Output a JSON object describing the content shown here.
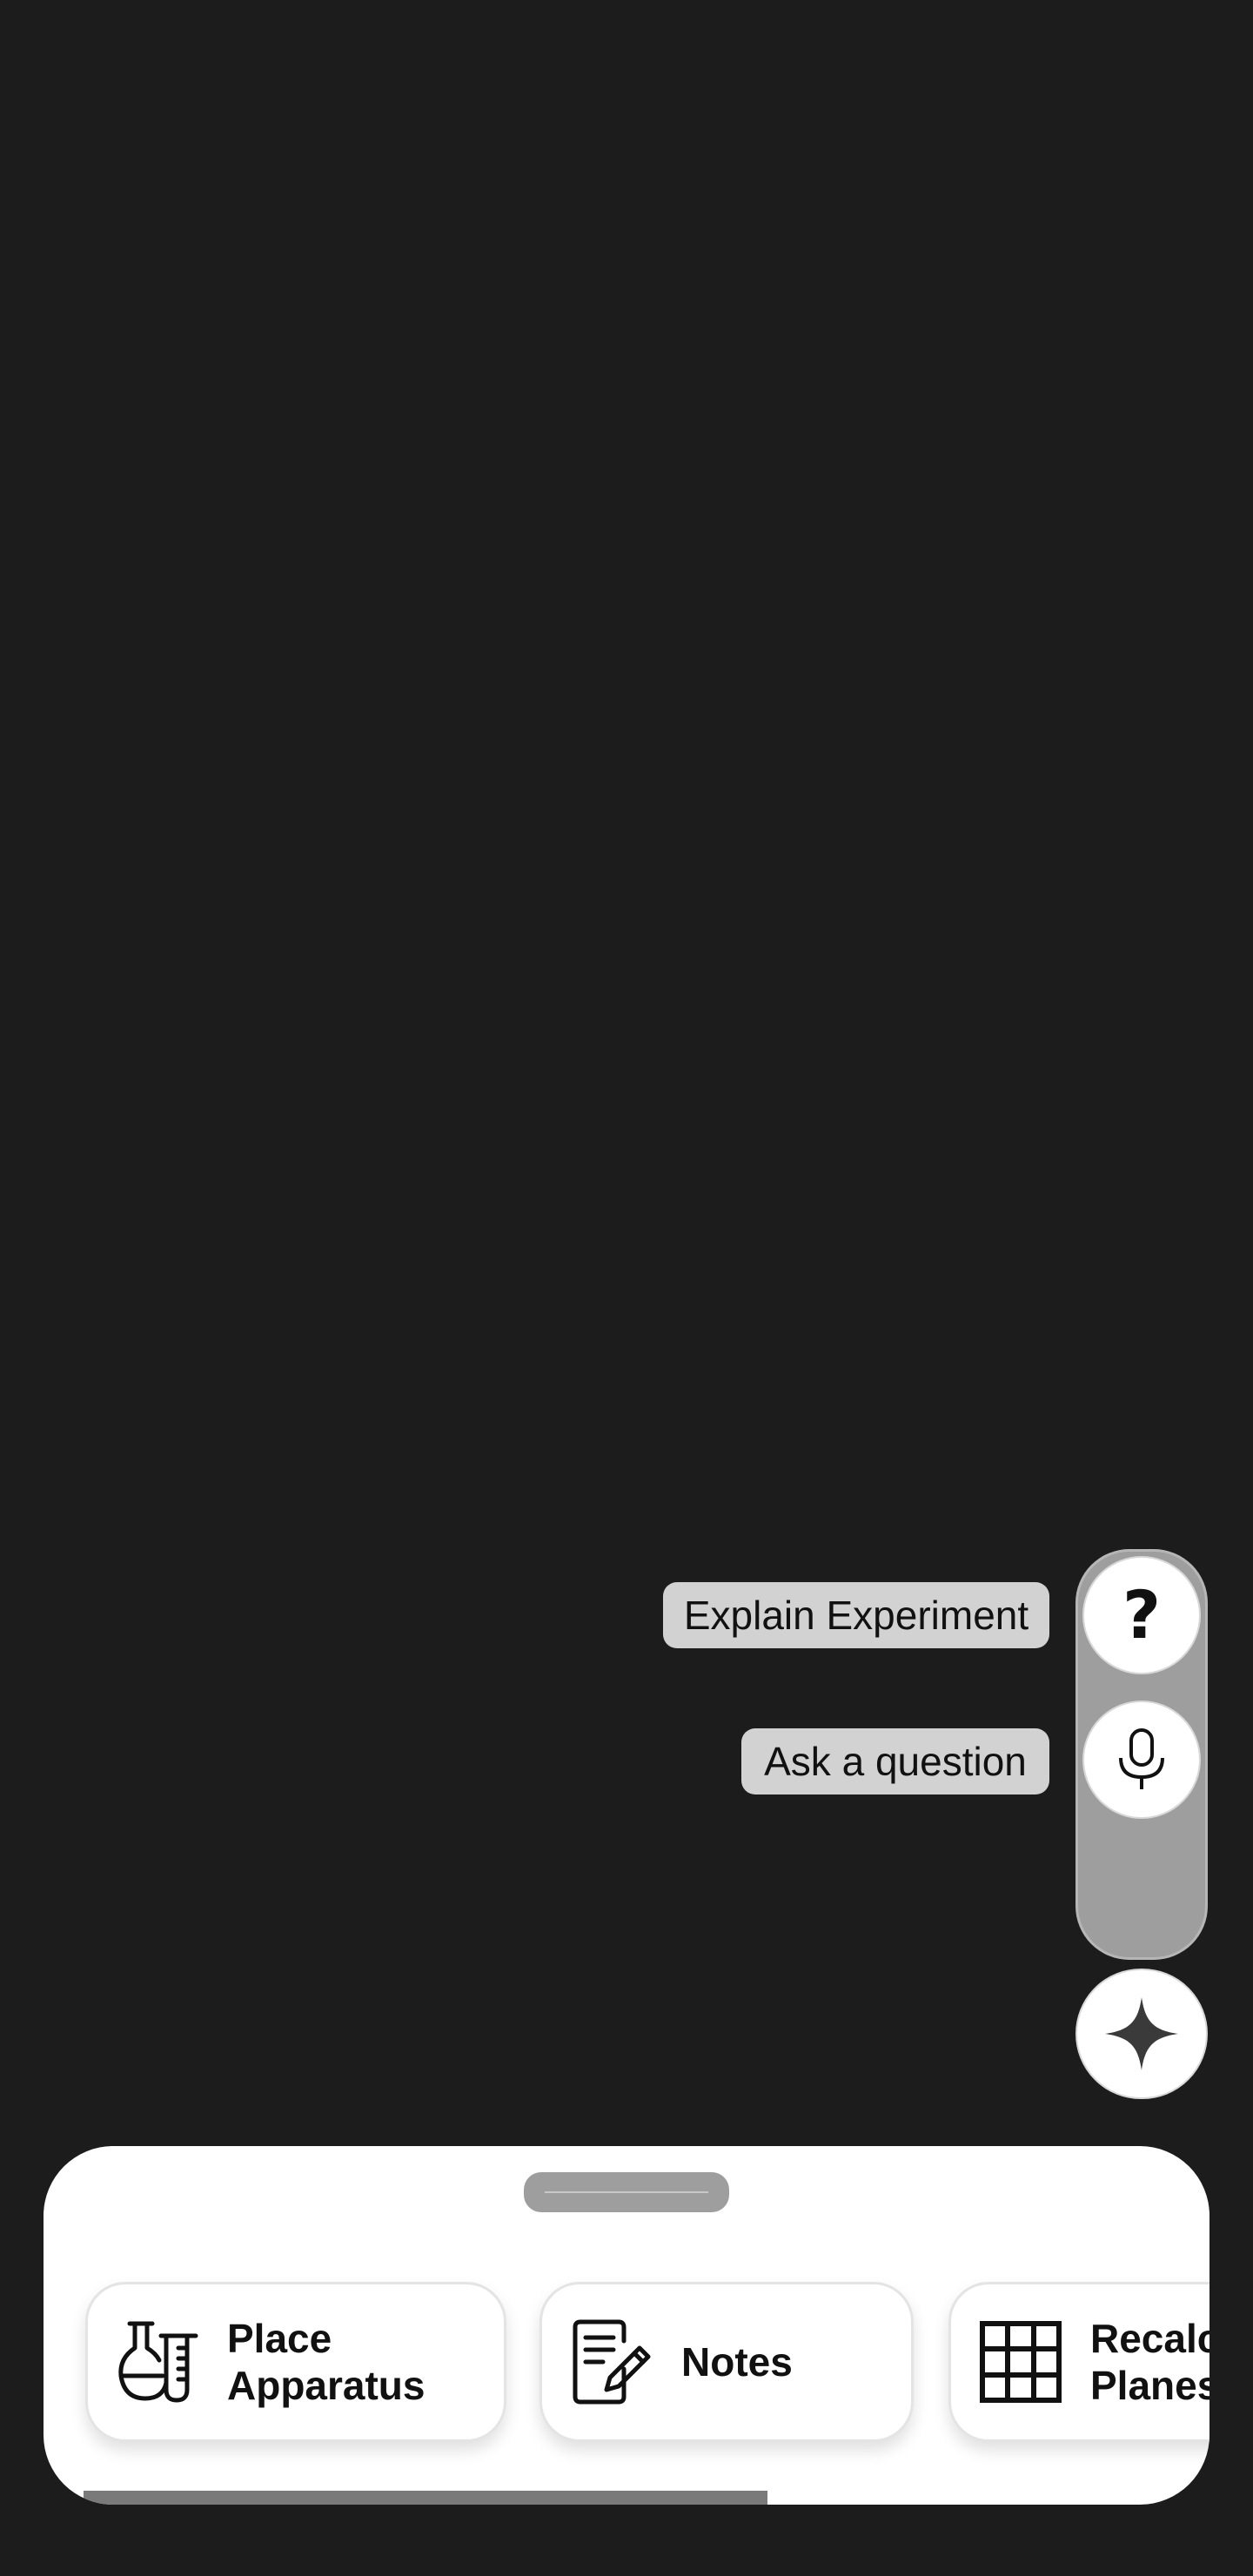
{
  "fab_menu": {
    "explain_label": "Explain Experiment",
    "ask_label": "Ask a question",
    "help_glyph": "?",
    "icons": {
      "help": "question-mark-icon",
      "mic": "microphone-icon",
      "main": "sparkle-icon"
    }
  },
  "bottom_sheet": {
    "tools": [
      {
        "label": "Place\nApparatus",
        "icon": "lab-flask-icon"
      },
      {
        "label": "Notes",
        "icon": "notes-pencil-icon"
      },
      {
        "label": "Recalc\nPlanes",
        "icon": "grid-icon"
      }
    ]
  },
  "colors": {
    "background": "#1c1c1c",
    "rail": "#9e9e9e",
    "label_bg": "#d2d2d2",
    "sheet": "#ffffff",
    "scrollbar": "#7a7a7a"
  }
}
